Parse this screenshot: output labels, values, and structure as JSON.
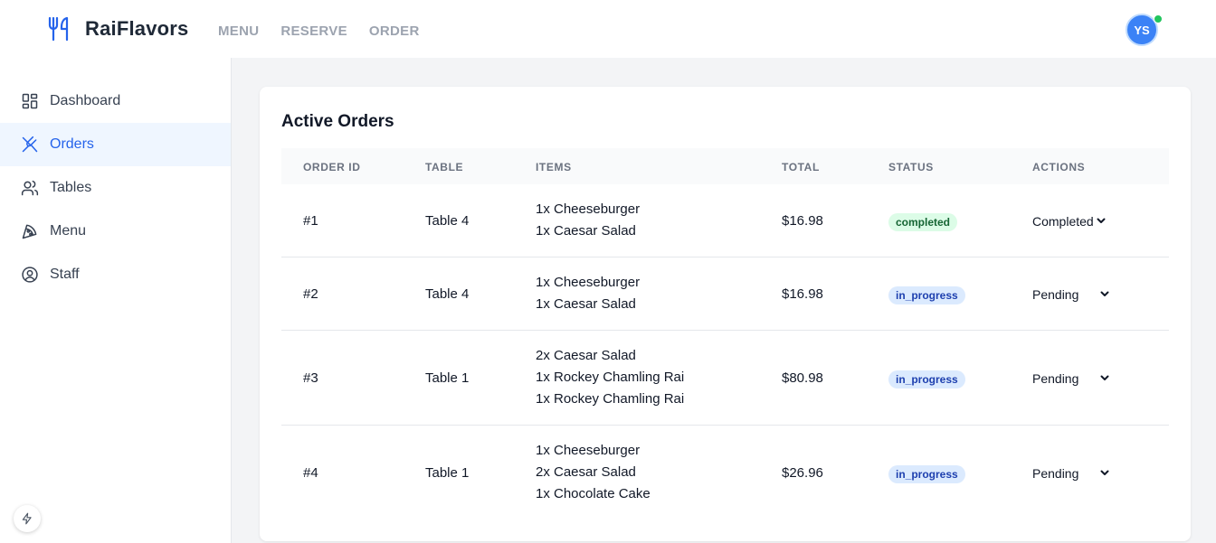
{
  "app": {
    "name": "RaiFlavors"
  },
  "topnav": [
    {
      "label": "MENU"
    },
    {
      "label": "RESERVE"
    },
    {
      "label": "ORDER"
    }
  ],
  "user": {
    "initials": "YS",
    "online": true
  },
  "sidebar": {
    "items": [
      {
        "label": "Dashboard",
        "icon": "dashboard-icon"
      },
      {
        "label": "Orders",
        "icon": "utensils-crossed-icon",
        "active": true
      },
      {
        "label": "Tables",
        "icon": "users-icon"
      },
      {
        "label": "Menu",
        "icon": "pizza-icon"
      },
      {
        "label": "Staff",
        "icon": "user-circle-icon"
      }
    ]
  },
  "orders": {
    "title": "Active Orders",
    "columns": [
      "ORDER ID",
      "TABLE",
      "ITEMS",
      "TOTAL",
      "STATUS",
      "ACTIONS"
    ],
    "rows": [
      {
        "id": "#1",
        "table": "Table 4",
        "items": [
          "1x Cheeseburger",
          "1x Caesar Salad"
        ],
        "total": "$16.98",
        "status": "completed",
        "action": "Completed"
      },
      {
        "id": "#2",
        "table": "Table 4",
        "items": [
          "1x Cheeseburger",
          "1x Caesar Salad"
        ],
        "total": "$16.98",
        "status": "in_progress",
        "action": "Pending"
      },
      {
        "id": "#3",
        "table": "Table 1",
        "items": [
          "2x Caesar Salad",
          "1x Rockey Chamling Rai",
          "1x Rockey Chamling Rai"
        ],
        "total": "$80.98",
        "status": "in_progress",
        "action": "Pending"
      },
      {
        "id": "#4",
        "table": "Table 1",
        "items": [
          "1x Cheeseburger",
          "2x Caesar Salad",
          "1x Chocolate Cake"
        ],
        "total": "$26.96",
        "status": "in_progress",
        "action": "Pending"
      }
    ]
  },
  "colors": {
    "accent": "#2563eb",
    "completed_badge_bg": "#dcfce7",
    "completed_badge_text": "#166534",
    "progress_badge_bg": "#dbeafe",
    "progress_badge_text": "#1e40af",
    "online": "#22c55e"
  }
}
